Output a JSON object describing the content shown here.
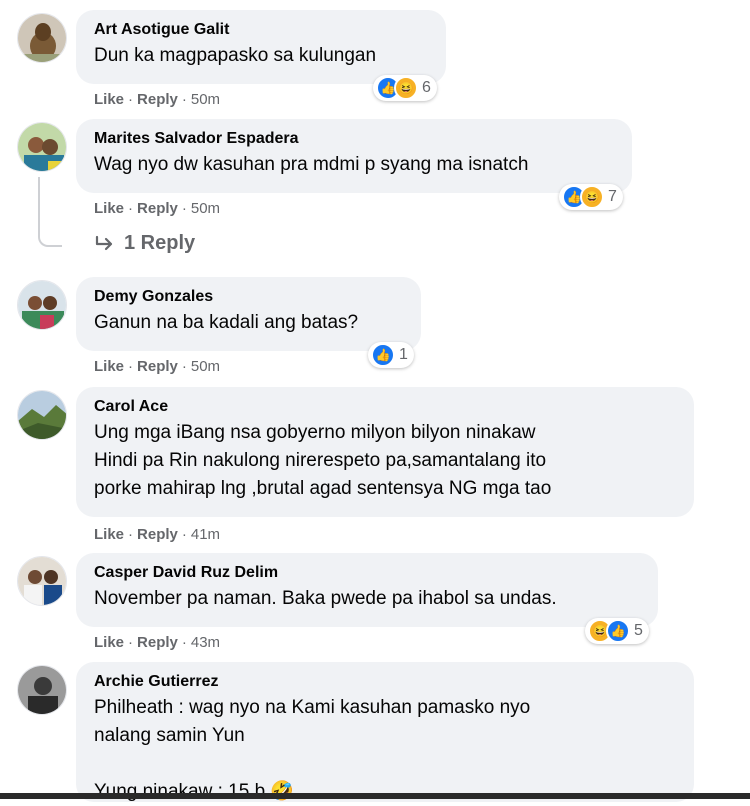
{
  "actions": {
    "like": "Like",
    "reply": "Reply"
  },
  "colors": {
    "like_blue": "#1877f2",
    "haha_yellow": "#f7b125",
    "bubble_bg": "#f0f2f5",
    "meta_gray": "#65676b"
  },
  "comments": [
    {
      "author": "Art Asotigue Galit",
      "text": "Dun ka magpapasko sa kulungan",
      "time": "50m",
      "reactions": [
        "like",
        "haha"
      ],
      "reaction_count": "6"
    },
    {
      "author": "Marites Salvador Espadera",
      "text": "Wag nyo dw kasuhan pra mdmi p syang ma isnatch",
      "time": "50m",
      "reactions": [
        "like",
        "haha"
      ],
      "reaction_count": "7",
      "replies_label": "1 Reply"
    },
    {
      "author": "Demy Gonzales",
      "text": "Ganun na ba kadali ang batas?",
      "time": "50m",
      "reactions": [
        "like"
      ],
      "reaction_count": "1"
    },
    {
      "author": "Carol Ace",
      "text": "Ung mga iBang nsa gobyerno milyon bilyon ninakaw\nHindi pa Rin nakulong nirerespeto pa,samantalang ito\nporke mahirap lng ,brutal agad sentensya NG mga tao",
      "time": "41m"
    },
    {
      "author": "Casper David Ruz Delim",
      "text": "November pa naman. Baka pwede pa ihabol sa undas.",
      "time": "43m",
      "reactions": [
        "haha",
        "like"
      ],
      "reaction_count": "5"
    },
    {
      "author": "Archie Gutierrez",
      "text": "Philheath : wag nyo na Kami kasuhan pamasko nyo\nnalang samin Yun\n\nYung ninakaw : 15 b",
      "emoji": "🤣"
    }
  ]
}
